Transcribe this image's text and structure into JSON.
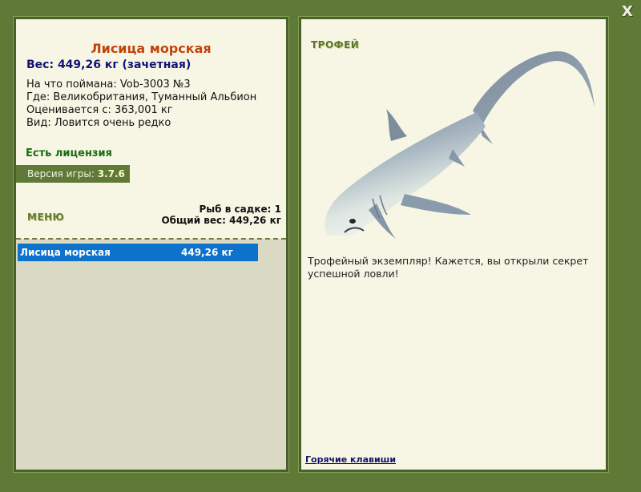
{
  "window": {
    "close_label": "X"
  },
  "fish": {
    "name": "Лисица морская",
    "weight": "Вес: 449,26 кг (зачетная)",
    "caught_on": "На что поймана: Vob-3003 №3",
    "location": "Где: Великобритания, Туманный Альбион",
    "value": "Оценивается с: 363,001 кг",
    "rarity": "Вид: Ловится очень редко"
  },
  "license": "Есть лицензия",
  "version": {
    "label": "Версия игры:",
    "value": "3.7.6"
  },
  "menu_label": "МЕНЮ",
  "keepnet": {
    "count": "Рыб в садке: 1",
    "total": "Общий вес: 449,26 кг"
  },
  "catch_list": [
    {
      "name": "Лисица морская",
      "weight": "449,26 кг"
    }
  ],
  "trophy": {
    "title": "ТРОФЕЙ",
    "description": "Трофейный экземпляр! Кажется, вы открыли секрет успешной ловли!"
  },
  "hotkeys_label": "Горячие клавиши",
  "colors": {
    "frame": "#5f7a37",
    "panel_bg": "#f7f6e5",
    "title": "#c1440e",
    "weight": "#12127a",
    "selected_row": "#0d72cc"
  }
}
